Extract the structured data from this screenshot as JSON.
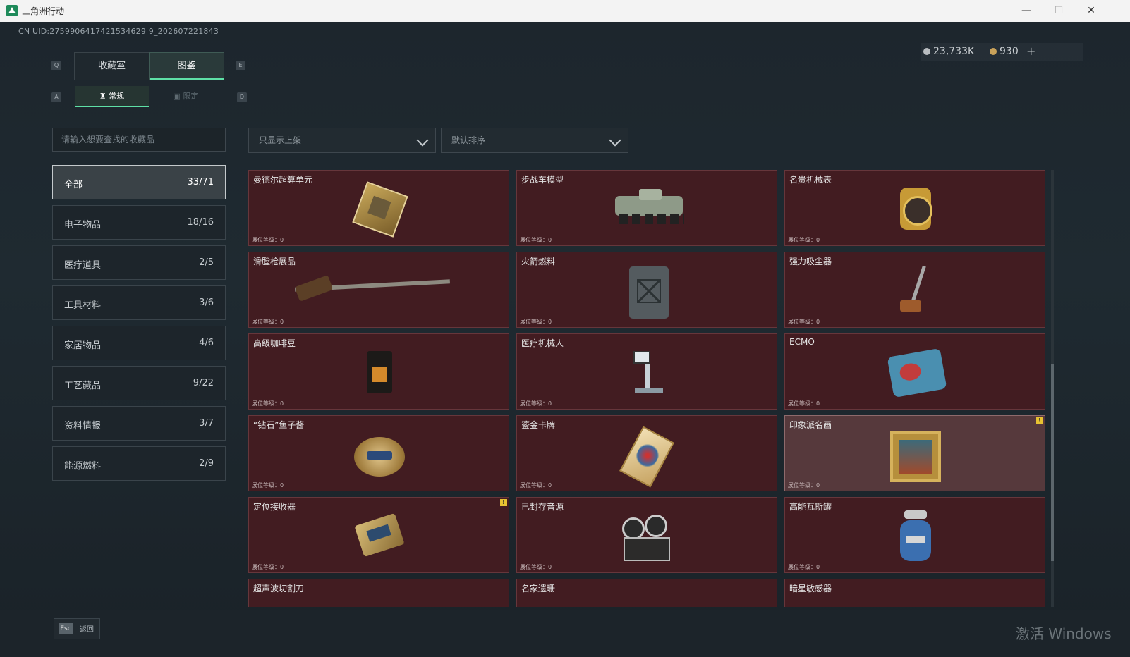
{
  "window": {
    "title": "三角洲行动",
    "minimize": "—",
    "maximize": "☐",
    "close": "✕"
  },
  "header": {
    "uid": "CN UID:2759906417421534629 9_202607221843"
  },
  "currency": {
    "silver": "23,733K",
    "gold": "930",
    "add": "+"
  },
  "tabs": {
    "collection_room": "收藏室",
    "catalog": "图鉴",
    "key_left": "Q",
    "key_right": "E"
  },
  "subtabs": {
    "regular": "常规",
    "limited": "限定",
    "key_left": "A",
    "key_right": "D"
  },
  "search": {
    "placeholder": "请输入想要查找的收藏品"
  },
  "filters": {
    "shelf": "只显示上架",
    "sort": "默认排序"
  },
  "categories": [
    {
      "label": "全部",
      "count": "33/71"
    },
    {
      "label": "电子物品",
      "count": "18/16"
    },
    {
      "label": "医疗道具",
      "count": "2/5"
    },
    {
      "label": "工具材料",
      "count": "3/6"
    },
    {
      "label": "家居物品",
      "count": "4/6"
    },
    {
      "label": "工艺藏品",
      "count": "9/22"
    },
    {
      "label": "资料情报",
      "count": "3/7"
    },
    {
      "label": "能源燃料",
      "count": "2/9"
    }
  ],
  "items": [
    {
      "name": "曼德尔超算单元",
      "level": "展位等级：0"
    },
    {
      "name": "步战车模型",
      "level": "展位等级：0"
    },
    {
      "name": "名贵机械表",
      "level": "展位等级：0"
    },
    {
      "name": "滑膛枪展品",
      "level": "展位等级：0"
    },
    {
      "name": "火箭燃料",
      "level": "展位等级：0"
    },
    {
      "name": "强力吸尘器",
      "level": "展位等级：0"
    },
    {
      "name": "高级咖啡豆",
      "level": "展位等级：0"
    },
    {
      "name": "医疗机械人",
      "level": "展位等级：0"
    },
    {
      "name": "ECMO",
      "level": "展位等级：0"
    },
    {
      "name": "“钻石”鱼子酱",
      "level": "展位等级：0"
    },
    {
      "name": "鎏金卡牌",
      "level": "展位等级：0"
    },
    {
      "name": "印象派名画",
      "level": "展位等级：0"
    },
    {
      "name": "定位接收器",
      "level": "展位等级：0"
    },
    {
      "name": "已封存音源",
      "level": "展位等级：0"
    },
    {
      "name": "高能瓦斯罐",
      "level": "展位等级：0"
    },
    {
      "name": "超声波切割刀",
      "level": ""
    },
    {
      "name": "名家遗珊",
      "level": ""
    },
    {
      "name": "暗星敏感器",
      "level": ""
    }
  ],
  "item_icons": [
    "cpu-chip-icon",
    "ifv-model-icon",
    "watch-icon",
    "musket-icon",
    "fuel-can-icon",
    "vacuum-icon",
    "coffee-bag-icon",
    "medical-robot-icon",
    "ecmo-icon",
    "caviar-tin-icon",
    "gold-card-icon",
    "painting-icon",
    "receiver-icon",
    "tape-recorder-icon",
    "gas-canister-icon"
  ],
  "warn_mark": "!",
  "footer": {
    "esc_key": "Esc",
    "back": "返回"
  },
  "watermark": "激活 Windows",
  "colors": {
    "accent": "#5ee0a6",
    "card_bg": "#421c21",
    "warning": "#e7c232"
  }
}
